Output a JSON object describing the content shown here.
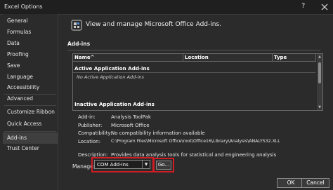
{
  "window": {
    "title": "Excel Options",
    "help": "?"
  },
  "sidebar": {
    "items": [
      {
        "label": "General"
      },
      {
        "label": "Formulas"
      },
      {
        "label": "Data"
      },
      {
        "label": "Proofing"
      },
      {
        "label": "Save"
      },
      {
        "label": "Language"
      },
      {
        "label": "Accessibility"
      },
      {
        "label": "Advanced"
      },
      {
        "label": "Customize Ribbon"
      },
      {
        "label": "Quick Access Toolbar"
      },
      {
        "label": "Add-ins"
      },
      {
        "label": "Trust Center"
      }
    ],
    "active": "Add-ins"
  },
  "main": {
    "header": "View and manage Microsoft Office Add-ins.",
    "section_title": "Add-ins",
    "table": {
      "columns": [
        "Name^",
        "Location",
        "Type"
      ],
      "groups": [
        {
          "title": "Active Application Add-ins",
          "empty": "No Active Application Add-ins"
        },
        {
          "title": "Inactive Application Add-ins"
        }
      ]
    },
    "details": [
      {
        "label": "Add-in:",
        "value": "Analysis ToolPak"
      },
      {
        "label": "Publisher:",
        "value": "Microsoft Office"
      },
      {
        "label": "Compatibility:",
        "value": "No compatibility information available"
      },
      {
        "label": "Location:",
        "value": "C:\\Program Files\\Microsoft Office\\root\\Office16\\Library\\Analysis\\ANALYS32.XLL"
      },
      {
        "label": "Description:",
        "value": "Provides data analysis tools for statistical and engineering analysis"
      }
    ],
    "manage": {
      "label": "Manage:",
      "selected": "COM Add-ins",
      "go_label": "Go..."
    }
  },
  "footer": {
    "ok_label": "OK",
    "cancel_label": "Cancel"
  },
  "colors": {
    "highlight": "#d11c24",
    "background": "#2b2b2b"
  }
}
